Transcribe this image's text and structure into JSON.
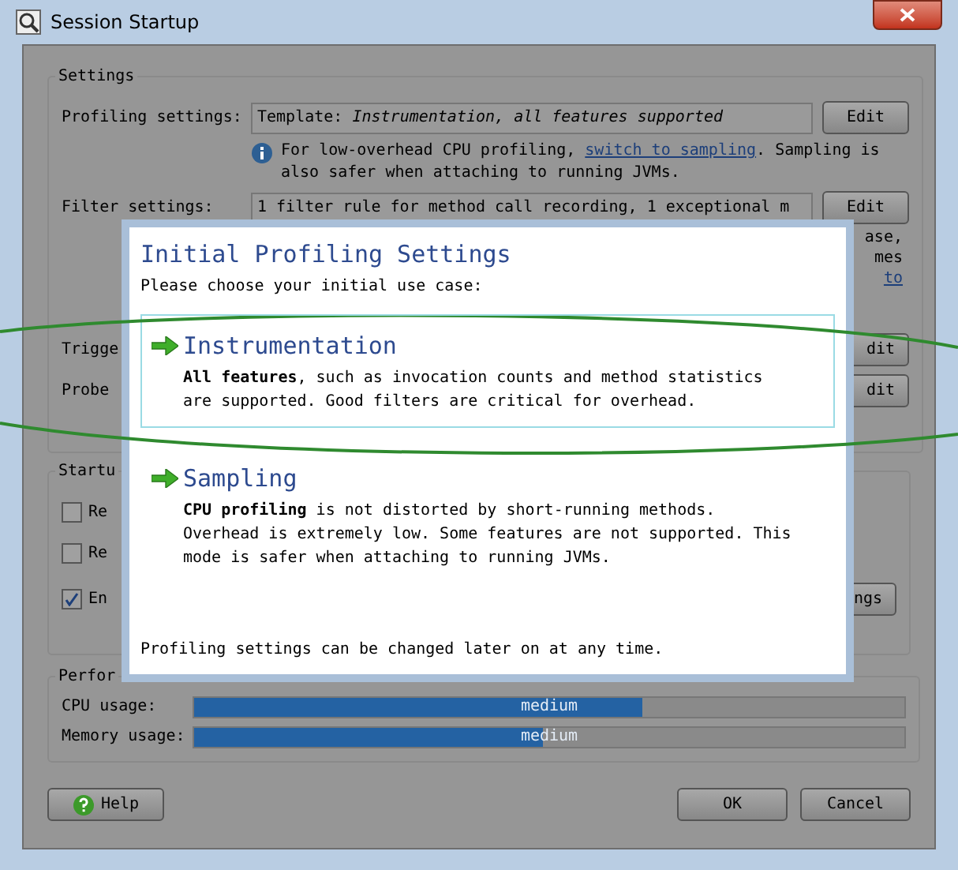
{
  "window": {
    "title": "Session Startup"
  },
  "settings": {
    "legend": "Settings",
    "profiling": {
      "label": "Profiling settings:",
      "value": "Template: *Instrumentation, all features supported*",
      "button": "Edit"
    },
    "info": {
      "before": "For low-overhead CPU profiling, ",
      "link": "switch to sampling",
      "after": ". Sampling is also safer when attaching to running JVMs."
    },
    "filter": {
      "label": "Filter settings:",
      "value": "1 filter rule for method call recording, 1 exceptional m",
      "button": "Edit"
    },
    "fragments": [
      {
        "text": "ase,",
        "kind": "text"
      },
      {
        "text": "mes",
        "kind": "text"
      },
      {
        "text": "to",
        "kind": "link"
      }
    ],
    "rows": [
      {
        "label": "Trigge",
        "button": "dit"
      },
      {
        "label": "Probe",
        "button": "dit"
      }
    ]
  },
  "startup": {
    "legend": "Startu",
    "checkboxes": [
      {
        "label": "Re",
        "checked": false
      },
      {
        "label": "Re",
        "checked": false
      },
      {
        "label": "En",
        "checked": true
      }
    ],
    "button": "ngs"
  },
  "performance": {
    "legend": "Perfor",
    "meters": [
      {
        "label": "CPU usage:",
        "level": 0.63,
        "reading": "medium"
      },
      {
        "label": "Memory usage:",
        "level": 0.49,
        "reading": "medium"
      }
    ]
  },
  "buttons": {
    "help": "Help",
    "ok": "OK",
    "cancel": "Cancel"
  },
  "popup": {
    "title": "Initial Profiling Settings",
    "prompt": "Please choose your initial use case:",
    "options": [
      {
        "title": "Instrumentation",
        "text": "**All features**, such as invocation counts and method statistics are supported. Good filters are critical for overhead.",
        "selected": true
      },
      {
        "title": "Sampling",
        "text": "**CPU profiling** is not distorted by short-running methods. Overhead is extremely low. Some features are not supported. This mode is safer when attaching to running JVMs.",
        "selected": false
      }
    ],
    "footer": "Profiling settings can be changed later on at any time."
  }
}
